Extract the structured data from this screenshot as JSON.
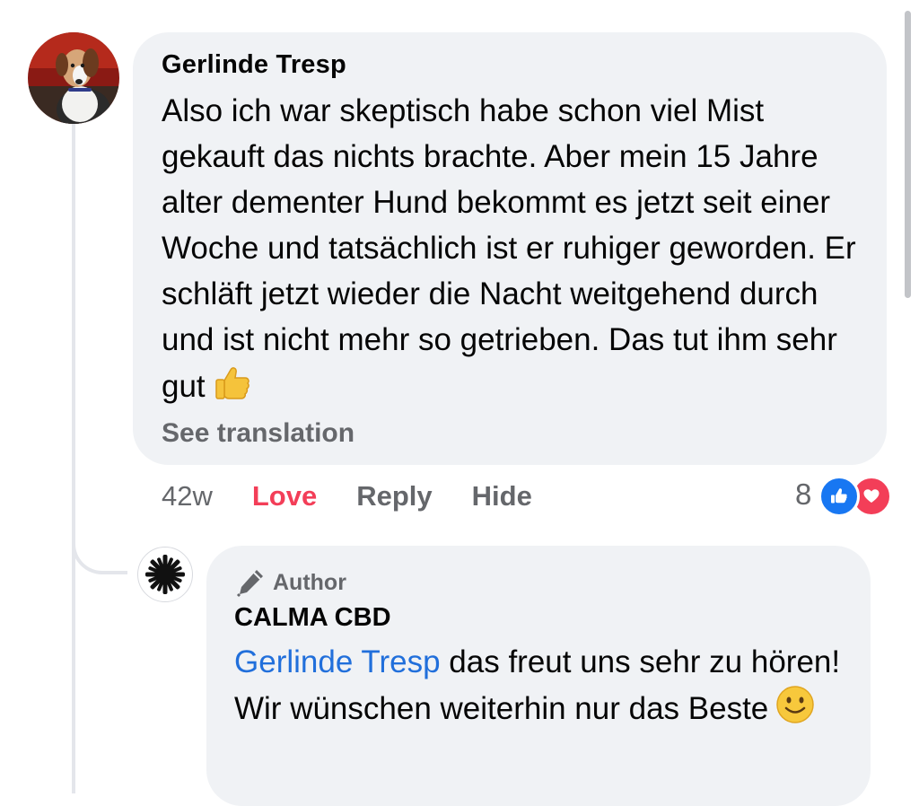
{
  "comment": {
    "author": "Gerlinde Tresp",
    "text": "Also ich war skeptisch habe schon viel Mist gekauft das nichts brachte. Aber mein 15 Jahre alter dementer Hund bekommt es jetzt seit einer Woche und tatsächlich ist er ruhiger geworden. Er schläft jetzt wieder die Nacht weitgehend durch und ist nicht mehr so getrieben. Das tut ihm sehr gut",
    "emoji": "thumbs-up-emoji",
    "see_translation": "See translation",
    "time": "42w",
    "love_label": "Love",
    "reply_label": "Reply",
    "hide_label": "Hide",
    "reaction_count": "8",
    "reaction_icons": [
      "like-icon",
      "love-icon"
    ]
  },
  "reply": {
    "badge": "Author",
    "author": "CALMA CBD",
    "mention": "Gerlinde Tresp",
    "text": " das freut uns sehr zu hören! Wir wünschen weiterhin nur das Beste",
    "emoji": "smiling-face-emoji"
  },
  "colors": {
    "bubble": "#f0f2f5",
    "love": "#f33e58",
    "like": "#1877f2",
    "mention": "#216fdb",
    "secondary_text": "#65676b"
  }
}
